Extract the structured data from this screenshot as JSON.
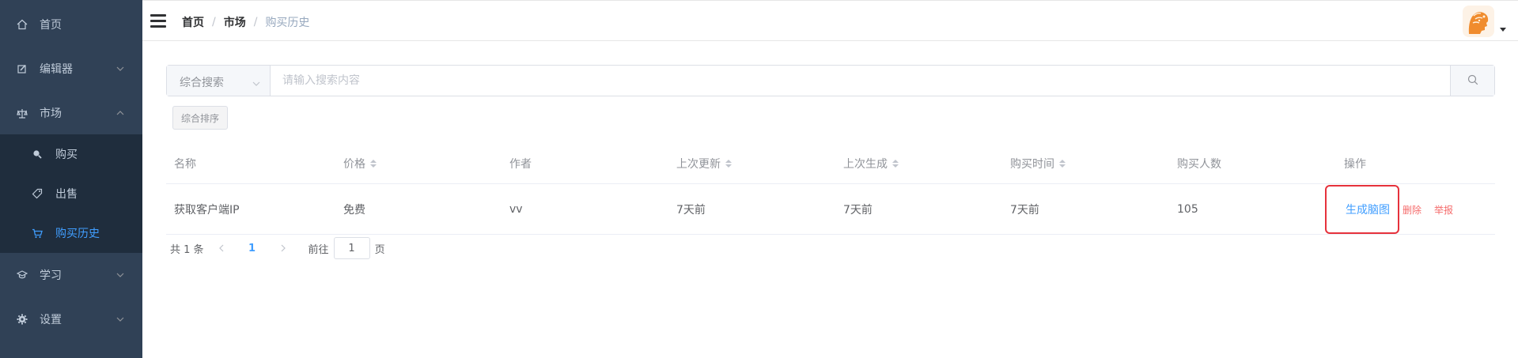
{
  "sidebar": {
    "items": [
      {
        "label": "首页",
        "icon": "home-icon"
      },
      {
        "label": "编辑器",
        "icon": "edit-icon"
      },
      {
        "label": "市场",
        "icon": "scale-icon"
      },
      {
        "label": "学习",
        "icon": "graduation-icon"
      },
      {
        "label": "设置",
        "icon": "gear-icon"
      }
    ],
    "market_sub": [
      {
        "label": "购买",
        "icon": "search-icon"
      },
      {
        "label": "出售",
        "icon": "tag-icon"
      },
      {
        "label": "购买历史",
        "icon": "cart-icon",
        "active": true
      }
    ],
    "colors": {
      "bg": "#304156",
      "sub_bg": "#1f2d3d",
      "text": "#bfcbd9",
      "active": "#409eff"
    }
  },
  "navbar": {
    "breadcrumb": [
      "首页",
      "市场",
      "购买历史"
    ],
    "separator": "/"
  },
  "search": {
    "select_label": "综合搜索",
    "placeholder": "请输入搜索内容",
    "sort_label": "综合排序"
  },
  "table": {
    "headers": [
      "名称",
      "价格",
      "作者",
      "上次更新",
      "上次生成",
      "购买时间",
      "购买人数",
      "操作"
    ],
    "rows": [
      {
        "name": "获取客户端IP",
        "price": "免费",
        "author": "vv",
        "last_update": "7天前",
        "last_generate": "7天前",
        "purchase_time": "7天前",
        "buyers": "105"
      }
    ],
    "actions": {
      "generate": "生成脑图",
      "delete": "删除",
      "report": "举报"
    }
  },
  "pagination": {
    "total_label": "共 1 条",
    "current_page": "1",
    "goto_label": "前往",
    "goto_value": "1",
    "page_suffix": "页"
  },
  "accent": "#409eff",
  "danger": "#f56c6c"
}
